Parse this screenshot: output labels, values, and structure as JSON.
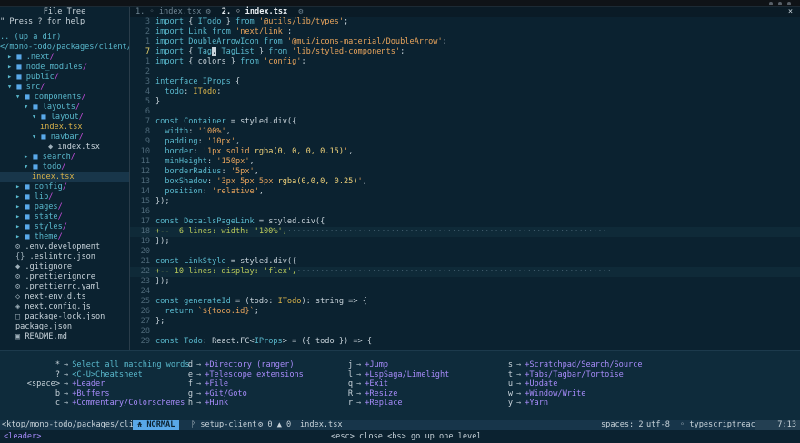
{
  "tree": {
    "title": "File Tree",
    "help": "\" Press ? for help",
    "updir": ".. (up a dir)",
    "root": "</mono-todo/packages/client/",
    "items": [
      {
        "indent": 0,
        "chev": "▸",
        "icon": "■",
        "name": ".next",
        "slash": "/",
        "kind": "dir"
      },
      {
        "indent": 0,
        "chev": "▸",
        "icon": "■",
        "name": "node_modules",
        "slash": "/",
        "kind": "dir"
      },
      {
        "indent": 0,
        "chev": "▸",
        "icon": "■",
        "name": "public",
        "slash": "/",
        "kind": "dir"
      },
      {
        "indent": 0,
        "chev": "▾",
        "icon": "■",
        "name": "src",
        "slash": "/",
        "kind": "dir"
      },
      {
        "indent": 1,
        "chev": "▾",
        "icon": "■",
        "name": "components",
        "slash": "/",
        "kind": "dir"
      },
      {
        "indent": 2,
        "chev": "▾",
        "icon": "■",
        "name": "layouts",
        "slash": "/",
        "kind": "dir"
      },
      {
        "indent": 3,
        "chev": "▾",
        "icon": "■",
        "name": "layout",
        "slash": "/",
        "kind": "dir"
      },
      {
        "indent": 4,
        "chev": "",
        "icon": "",
        "name": "index.tsx",
        "slash": "",
        "kind": "yel"
      },
      {
        "indent": 3,
        "chev": "▾",
        "icon": "■",
        "name": "navbar",
        "slash": "/",
        "kind": "dir"
      },
      {
        "indent": 5,
        "chev": "",
        "icon": "◆",
        "name": "index.tsx",
        "slash": "",
        "kind": "file"
      },
      {
        "indent": 2,
        "chev": "▸",
        "icon": "■",
        "name": "search",
        "slash": "/",
        "kind": "dir"
      },
      {
        "indent": 2,
        "chev": "▾",
        "icon": "■",
        "name": "todo",
        "slash": "/",
        "kind": "dir"
      },
      {
        "indent": 3,
        "chev": "",
        "icon": "",
        "name": "index.tsx",
        "slash": "",
        "kind": "yel",
        "selected": true
      },
      {
        "indent": 1,
        "chev": "▸",
        "icon": "■",
        "name": "config",
        "slash": "/",
        "kind": "dir"
      },
      {
        "indent": 1,
        "chev": "▸",
        "icon": "■",
        "name": "lib",
        "slash": "/",
        "kind": "dir"
      },
      {
        "indent": 1,
        "chev": "▸",
        "icon": "■",
        "name": "pages",
        "slash": "/",
        "kind": "dir"
      },
      {
        "indent": 1,
        "chev": "▸",
        "icon": "■",
        "name": "state",
        "slash": "/",
        "kind": "dir"
      },
      {
        "indent": 1,
        "chev": "▸",
        "icon": "■",
        "name": "styles",
        "slash": "/",
        "kind": "dir"
      },
      {
        "indent": 1,
        "chev": "▸",
        "icon": "■",
        "name": "theme",
        "slash": "/",
        "kind": "dir"
      },
      {
        "indent": 1,
        "chev": "",
        "icon": "⚙",
        "name": ".env.development",
        "slash": "",
        "kind": "file"
      },
      {
        "indent": 1,
        "chev": "",
        "icon": "{}",
        "name": ".eslintrc.json",
        "slash": "",
        "kind": "file"
      },
      {
        "indent": 1,
        "chev": "",
        "icon": "◆",
        "name": ".gitignore",
        "slash": "",
        "kind": "file"
      },
      {
        "indent": 1,
        "chev": "",
        "icon": "⚙",
        "name": ".prettierignore",
        "slash": "",
        "kind": "file"
      },
      {
        "indent": 1,
        "chev": "",
        "icon": "⚙",
        "name": ".prettierrc.yaml",
        "slash": "",
        "kind": "file"
      },
      {
        "indent": 1,
        "chev": "",
        "icon": "◇",
        "name": "next-env.d.ts",
        "slash": "",
        "kind": "file"
      },
      {
        "indent": 1,
        "chev": "",
        "icon": "◈",
        "name": "next.config.js",
        "slash": "",
        "kind": "file"
      },
      {
        "indent": 1,
        "chev": "",
        "icon": "□",
        "name": "package-lock.json",
        "slash": "",
        "kind": "file"
      },
      {
        "indent": 1,
        "chev": "",
        "icon": "",
        "name": "package.json",
        "slash": "",
        "kind": "file"
      },
      {
        "indent": 1,
        "chev": "",
        "icon": "▣",
        "name": "README.md",
        "slash": "",
        "kind": "file"
      }
    ]
  },
  "tabs": [
    {
      "label": "1. ◦ index.tsx  ⚙ ",
      "active": false
    },
    {
      "label": "2. ◦ index.tsx",
      "active": true
    },
    {
      "label": " ⚙",
      "active": false
    }
  ],
  "tabclose": "×",
  "code": [
    {
      "n": "3",
      "html": [
        [
          "kw",
          "import"
        ],
        [
          "pl",
          " { "
        ],
        [
          "fn",
          "ITodo"
        ],
        [
          "pl",
          " } "
        ],
        [
          "kw",
          "from"
        ],
        [
          "pl",
          " "
        ],
        [
          "str",
          "'@utils/lib/types'"
        ],
        [
          "pl",
          ";"
        ]
      ]
    },
    {
      "n": "2",
      "html": [
        [
          "kw",
          "import"
        ],
        [
          "pl",
          " "
        ],
        [
          "fn",
          "Link"
        ],
        [
          "pl",
          " "
        ],
        [
          "kw",
          "from"
        ],
        [
          "pl",
          " "
        ],
        [
          "str",
          "'next/link'"
        ],
        [
          "pl",
          ";"
        ]
      ]
    },
    {
      "n": "1",
      "html": [
        [
          "kw",
          "import"
        ],
        [
          "pl",
          " "
        ],
        [
          "fn",
          "DoubleArrowIcon"
        ],
        [
          "pl",
          " "
        ],
        [
          "kw",
          "from"
        ],
        [
          "pl",
          " "
        ],
        [
          "str",
          "'@mui/icons-material/DoubleArrow'"
        ],
        [
          "pl",
          ";"
        ]
      ]
    },
    {
      "n": "7",
      "cur": true,
      "html": [
        [
          "kw",
          "import"
        ],
        [
          "pl",
          " { "
        ],
        [
          "fn",
          "Tag"
        ],
        [
          "cursor",
          ","
        ],
        [
          "pl",
          " "
        ],
        [
          "fn",
          "TagList"
        ],
        [
          "pl",
          " } "
        ],
        [
          "kw",
          "from"
        ],
        [
          "pl",
          " "
        ],
        [
          "str",
          "'lib/styled-components'"
        ],
        [
          "pl",
          ";"
        ]
      ]
    },
    {
      "n": "1",
      "html": [
        [
          "kw",
          "import"
        ],
        [
          "pl",
          " { colors } "
        ],
        [
          "kw",
          "from"
        ],
        [
          "pl",
          " "
        ],
        [
          "str",
          "'config'"
        ],
        [
          "pl",
          ";"
        ]
      ]
    },
    {
      "n": "2",
      "html": []
    },
    {
      "n": "3",
      "html": [
        [
          "kw",
          "interface"
        ],
        [
          "pl",
          " "
        ],
        [
          "fn",
          "IProps"
        ],
        [
          "pl",
          " {"
        ]
      ]
    },
    {
      "n": "4",
      "html": [
        [
          "pl",
          "  "
        ],
        [
          "prop",
          "todo"
        ],
        [
          "pl",
          ": "
        ],
        [
          "id",
          "ITodo"
        ],
        [
          "pl",
          ";"
        ]
      ]
    },
    {
      "n": "5",
      "html": [
        [
          "pl",
          "}"
        ]
      ]
    },
    {
      "n": "6",
      "html": []
    },
    {
      "n": "7",
      "html": [
        [
          "kw",
          "const"
        ],
        [
          "pl",
          " "
        ],
        [
          "fn",
          "Container"
        ],
        [
          "pl",
          " = styled.div({"
        ]
      ]
    },
    {
      "n": "8",
      "html": [
        [
          "pl",
          "  "
        ],
        [
          "prop",
          "width"
        ],
        [
          "pl",
          ": "
        ],
        [
          "str",
          "'100%'"
        ],
        [
          "pl",
          ","
        ]
      ]
    },
    {
      "n": "9",
      "html": [
        [
          "pl",
          "  "
        ],
        [
          "prop",
          "padding"
        ],
        [
          "pl",
          ": "
        ],
        [
          "str",
          "'10px'"
        ],
        [
          "pl",
          ","
        ]
      ]
    },
    {
      "n": "10",
      "html": [
        [
          "pl",
          "  "
        ],
        [
          "prop",
          "border"
        ],
        [
          "pl",
          ": "
        ],
        [
          "str",
          "'1px solid "
        ],
        [
          "rgba",
          "rgba(0, 0, 0, 0.15)"
        ],
        [
          "str",
          "'"
        ],
        [
          "pl",
          ","
        ]
      ]
    },
    {
      "n": "11",
      "html": [
        [
          "pl",
          "  "
        ],
        [
          "prop",
          "minHeight"
        ],
        [
          "pl",
          ": "
        ],
        [
          "str",
          "'150px'"
        ],
        [
          "pl",
          ","
        ]
      ]
    },
    {
      "n": "12",
      "html": [
        [
          "pl",
          "  "
        ],
        [
          "prop",
          "borderRadius"
        ],
        [
          "pl",
          ": "
        ],
        [
          "str",
          "'5px'"
        ],
        [
          "pl",
          ","
        ]
      ]
    },
    {
      "n": "13",
      "html": [
        [
          "pl",
          "  "
        ],
        [
          "prop",
          "boxShadow"
        ],
        [
          "pl",
          ": "
        ],
        [
          "str",
          "'3px 5px 5px "
        ],
        [
          "rgba",
          "rgba(0,0,0, 0.25)"
        ],
        [
          "str",
          "'"
        ],
        [
          "pl",
          ","
        ]
      ]
    },
    {
      "n": "14",
      "html": [
        [
          "pl",
          "  "
        ],
        [
          "prop",
          "position"
        ],
        [
          "pl",
          ": "
        ],
        [
          "str",
          "'relative'"
        ],
        [
          "pl",
          ","
        ]
      ]
    },
    {
      "n": "15",
      "html": [
        [
          "pl",
          "});"
        ]
      ]
    },
    {
      "n": "16",
      "html": []
    },
    {
      "n": "17",
      "html": [
        [
          "kw",
          "const"
        ],
        [
          "pl",
          " "
        ],
        [
          "fn",
          "DetailsPageLink"
        ],
        [
          "pl",
          " = styled.div({"
        ]
      ]
    },
    {
      "n": "18",
      "fold": true,
      "html": [
        [
          "foldtxt",
          "+--  6 lines: width: '100%',"
        ],
        [
          "foldfill",
          "····································································"
        ]
      ]
    },
    {
      "n": "19",
      "html": [
        [
          "pl",
          "});"
        ]
      ]
    },
    {
      "n": "20",
      "html": []
    },
    {
      "n": "21",
      "html": [
        [
          "kw",
          "const"
        ],
        [
          "pl",
          " "
        ],
        [
          "fn",
          "LinkStyle"
        ],
        [
          "pl",
          " = styled.div({"
        ]
      ]
    },
    {
      "n": "22",
      "fold": true,
      "html": [
        [
          "foldtxt",
          "+-- 10 lines: display: 'flex',"
        ],
        [
          "foldfill",
          "···································································"
        ]
      ]
    },
    {
      "n": "23",
      "html": [
        [
          "pl",
          "});"
        ]
      ]
    },
    {
      "n": "24",
      "html": []
    },
    {
      "n": "25",
      "html": [
        [
          "kw",
          "const"
        ],
        [
          "pl",
          " "
        ],
        [
          "fn",
          "generateId"
        ],
        [
          "pl",
          " = (todo: "
        ],
        [
          "id",
          "ITodo"
        ],
        [
          "pl",
          "): string => {"
        ]
      ]
    },
    {
      "n": "26",
      "html": [
        [
          "pl",
          "  "
        ],
        [
          "kw",
          "return"
        ],
        [
          "pl",
          " "
        ],
        [
          "str",
          "`${todo.id}`"
        ],
        [
          "pl",
          ";"
        ]
      ]
    },
    {
      "n": "27",
      "html": [
        [
          "pl",
          "};"
        ]
      ]
    },
    {
      "n": "28",
      "html": []
    },
    {
      "n": "29",
      "html": [
        [
          "kw",
          "const"
        ],
        [
          "pl",
          " "
        ],
        [
          "fn",
          "Todo"
        ],
        [
          "pl",
          ": React.FC<"
        ],
        [
          "fn",
          "IProps"
        ],
        [
          "pl",
          "> = ({ todo }) => {"
        ]
      ]
    }
  ],
  "whichkey": [
    [
      {
        "key": "*",
        "desc": "Select all matching words",
        "plain": true
      },
      {
        "key": "?",
        "desc": "<C-U>Cheatsheet",
        "plain": true
      },
      {
        "key": "<space>",
        "desc": "+Leader"
      },
      {
        "key": "b",
        "desc": "+Buffers"
      },
      {
        "key": "c",
        "desc": "+Commentary/Colorschemes"
      }
    ],
    [
      {
        "key": "d",
        "desc": "+Directory (ranger)"
      },
      {
        "key": "e",
        "desc": "+Telescope extensions"
      },
      {
        "key": "f",
        "desc": "+File"
      },
      {
        "key": "g",
        "desc": "+Git/Goto"
      },
      {
        "key": "h",
        "desc": "+Hunk"
      }
    ],
    [
      {
        "key": "j",
        "desc": "+Jump"
      },
      {
        "key": "l",
        "desc": "+LspSaga/Limelight"
      },
      {
        "key": "q",
        "desc": "+Exit"
      },
      {
        "key": "R",
        "desc": "+Resize"
      },
      {
        "key": "r",
        "desc": "+Replace"
      }
    ],
    [
      {
        "key": "s",
        "desc": "+Scratchpad/Search/Source"
      },
      {
        "key": "t",
        "desc": "+Tabs/Tagbar/Tortoise"
      },
      {
        "key": "u",
        "desc": "+Update"
      },
      {
        "key": "w",
        "desc": "+Window/Write"
      },
      {
        "key": "y",
        "desc": "+Yarn"
      }
    ]
  ],
  "status": {
    "path": "<ktop/mono-todo/packages/client",
    "mode": "NORMAL",
    "branch": "setup-client",
    "diag": "⚙ 0 ▲ 0",
    "file": "index.tsx",
    "spaces": "spaces: 2",
    "encoding": "utf-8",
    "filetype": "◦ typescriptreact",
    "position": "7:13"
  },
  "cmdline": {
    "left": "<leader>",
    "center": "<esc> close <bs> go up one level"
  }
}
